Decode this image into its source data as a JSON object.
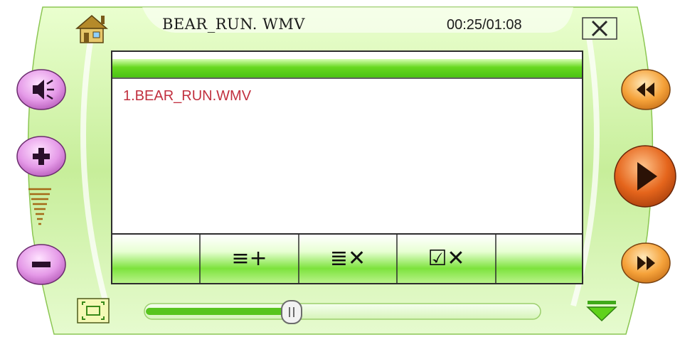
{
  "header": {
    "title": "BEAR_RUN. WMV",
    "time": "00:25/01:08"
  },
  "playlist": {
    "items": [
      "1.BEAR_RUN.WMV"
    ]
  },
  "toolbar": {
    "add_label": "≡+",
    "remove_label": "≣✕",
    "check_remove_label": "☑✕"
  },
  "progress": {
    "position_fraction": 0.37
  },
  "volume": {
    "level_fraction": 0.6
  },
  "colors": {
    "frame_green": "#c9ef9e",
    "bar_green": "#5ed31b",
    "playlist_text": "#c1303f",
    "volume_button": "#e59ae8",
    "transport_button": "#f5a23a",
    "play_button": "#e5651c"
  },
  "icons": {
    "home": "home-icon",
    "close": "close-icon",
    "mute": "mute-icon",
    "volume_up": "plus-icon",
    "volume_down": "minus-icon",
    "prev": "rewind-icon",
    "play": "play-icon",
    "next": "fast-forward-icon",
    "fullscreen": "fullscreen-icon",
    "collapse": "chevron-down-icon"
  }
}
